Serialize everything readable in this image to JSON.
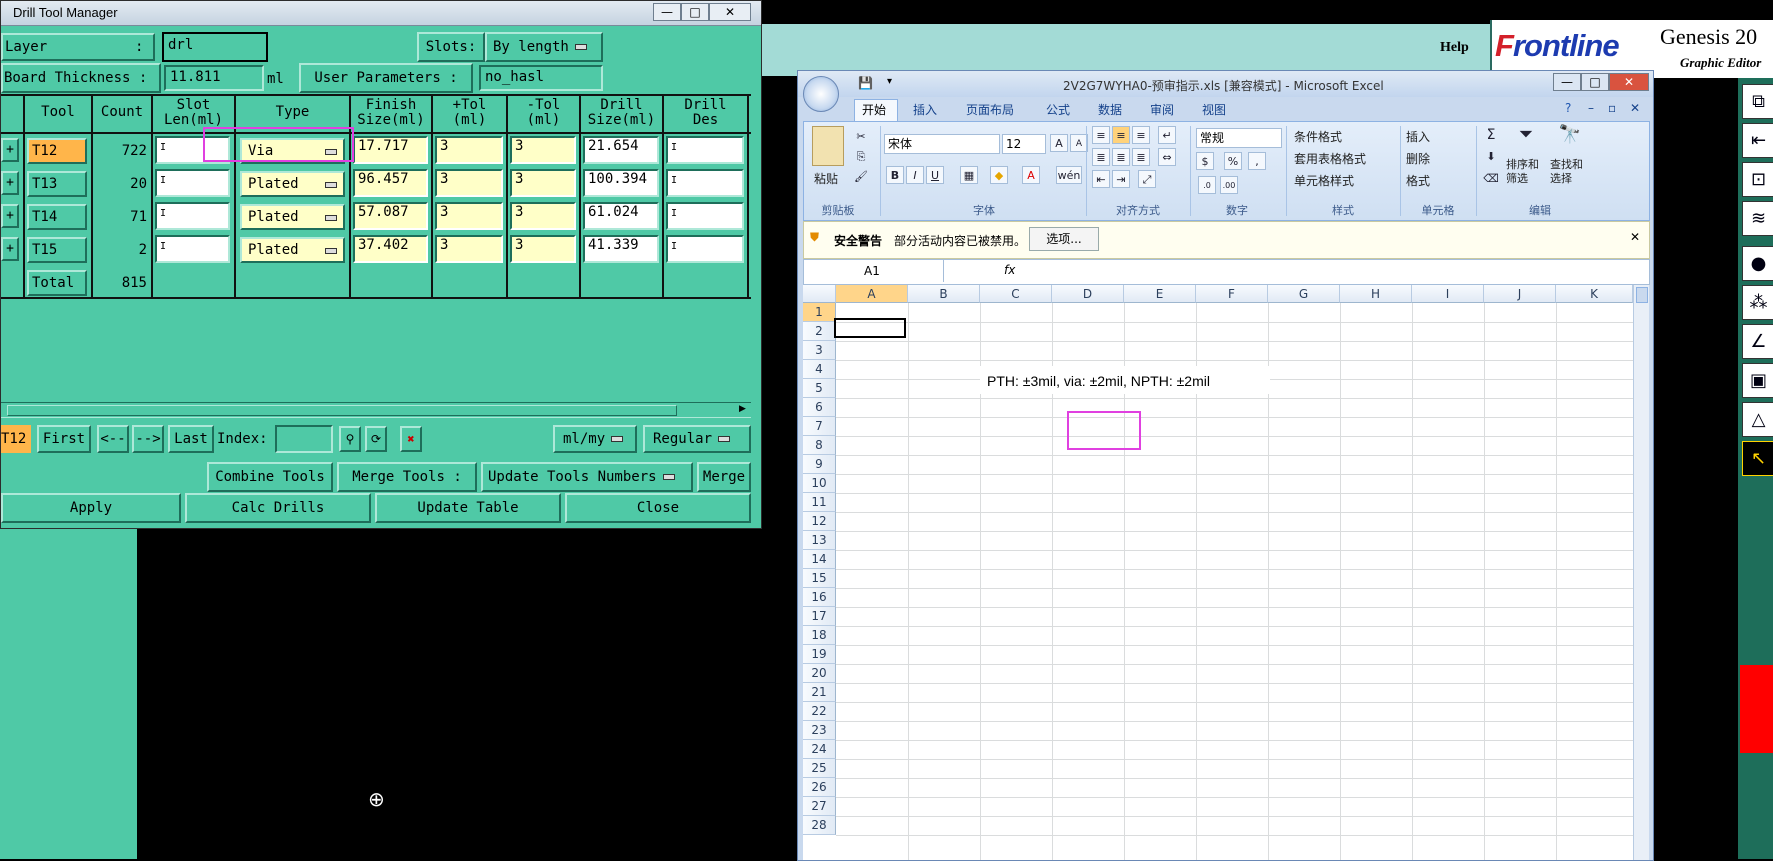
{
  "genesis": {
    "help_label": "Help",
    "logo_text_f": "F",
    "logo_text_rest": "rontline",
    "app_title": "Genesis 20",
    "app_subtitle": "Graphic Editor"
  },
  "drill_tool_manager": {
    "window_title": "Drill Tool Manager",
    "window_buttons": [
      "—",
      "□",
      "✕"
    ],
    "layer_label": "Layer",
    "layer_colon": ":",
    "layer_value": "drl",
    "slots_label": "Slots:",
    "slots_value": "By length",
    "board_thickness_label": "Board Thickness :",
    "board_thickness_value": "11.811",
    "board_thickness_unit": "ml",
    "user_params_label": "User Parameters :",
    "user_params_value": "no_hasl",
    "columns": [
      "Tool",
      "Count",
      "Slot\nLen(ml)",
      "Type",
      "Finish\nSize(ml)",
      "+Tol\n(ml)",
      "-Tol\n(ml)",
      "Drill\nSize(ml)",
      "Drill\nDes"
    ],
    "rows": [
      {
        "tool": "T12",
        "count": "722",
        "type": "Via",
        "finish": "17.717",
        "ptol": "3",
        "ntol": "3",
        "drill": "21.654",
        "selected": true
      },
      {
        "tool": "T13",
        "count": "20",
        "type": "Plated",
        "finish": "96.457",
        "ptol": "3",
        "ntol": "3",
        "drill": "100.394",
        "selected": false
      },
      {
        "tool": "T14",
        "count": "71",
        "type": "Plated",
        "finish": "57.087",
        "ptol": "3",
        "ntol": "3",
        "drill": "61.024",
        "selected": false
      },
      {
        "tool": "T15",
        "count": "2",
        "type": "Plated",
        "finish": "37.402",
        "ptol": "3",
        "ntol": "3",
        "drill": "41.339",
        "selected": false
      }
    ],
    "total_label": "Total",
    "total_count": "815",
    "nav": {
      "current": "T12",
      "first": "First",
      "prev": "<--",
      "next": "-->",
      "last": "Last",
      "index_label": "Index:",
      "index_value": "",
      "units": "ml/my",
      "mode": "Regular"
    },
    "buttons": {
      "combine_tools": "Combine Tools",
      "merge_tools_label": "Merge Tools :",
      "update_tools_numbers": "Update Tools Numbers",
      "merge": "Merge",
      "apply": "Apply",
      "calc_drills": "Calc Drills",
      "update_table": "Update Table",
      "close": "Close"
    }
  },
  "excel": {
    "window_title": "2V2G7WYHA0-预审指示.xls  [兼容模式] - Microsoft Excel",
    "tabs": [
      "开始",
      "插入",
      "页面布局",
      "公式",
      "数据",
      "审阅",
      "视图"
    ],
    "ribbon": {
      "paste": "粘贴",
      "clipboard": "剪贴板",
      "font_name": "宋体",
      "font_size": "12",
      "font_group": "字体",
      "align_group": "对齐方式",
      "number_format": "常规",
      "number_group": "数字",
      "cond_format": "条件格式",
      "table_format": "套用表格格式",
      "cell_style": "单元格样式",
      "style_group": "样式",
      "insert": "插入",
      "delete": "删除",
      "format": "格式",
      "cells_group": "单元格",
      "sort_filter": "排序和\n筛选",
      "find_select": "查找和\n选择",
      "edit_group": "编辑"
    },
    "security_title": "安全警告",
    "security_msg": "部分活动内容已被禁用。",
    "security_options": "选项...",
    "name_box": "A1",
    "fx": "fx",
    "columns": [
      "A",
      "B",
      "C",
      "D",
      "E",
      "F",
      "G",
      "H",
      "I",
      "J",
      "K"
    ],
    "rows": [
      "1",
      "2",
      "3",
      "4",
      "5",
      "6",
      "7",
      "8",
      "9",
      "10",
      "11",
      "12",
      "13",
      "14",
      "15",
      "16",
      "17",
      "18",
      "19",
      "20",
      "21",
      "22",
      "23",
      "24",
      "25",
      "26",
      "27",
      "28"
    ],
    "note_text": "PTH: ±3mil, via: ±2mil, NPTH: ±2mil"
  }
}
